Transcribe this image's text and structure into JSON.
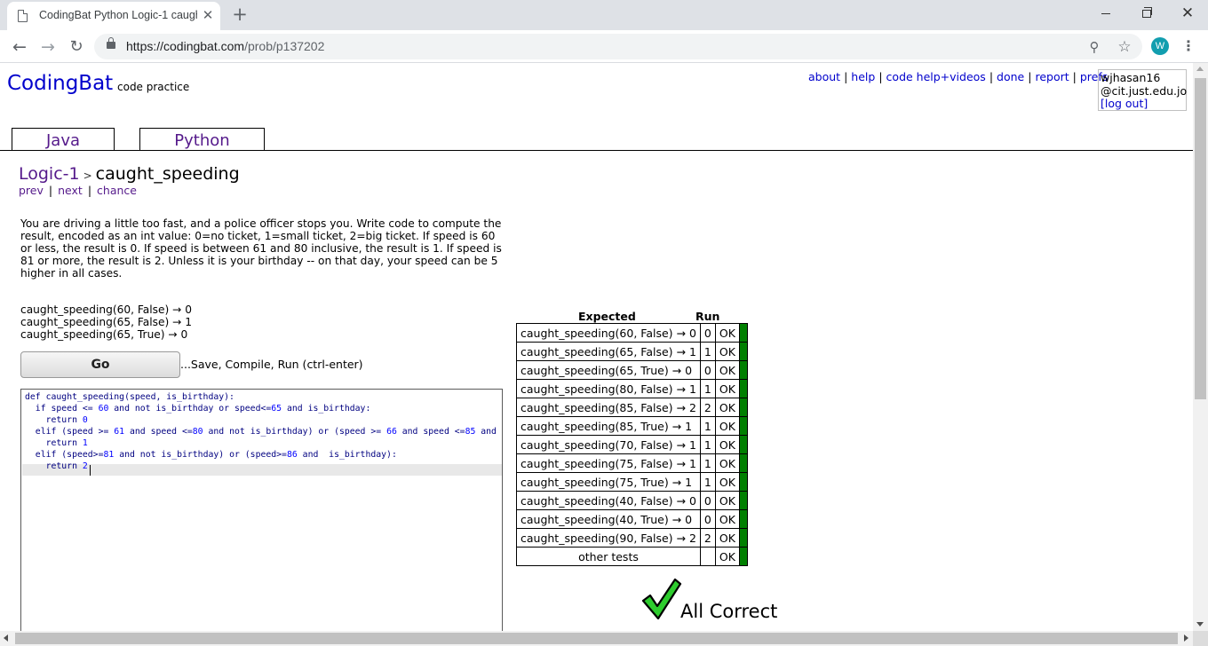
{
  "browser": {
    "tab_title": "CodingBat Python Logic-1 caugh",
    "tab_close": "✕",
    "new_tab": "+",
    "url_host": "https://codingbat.com",
    "url_path": "/prob/p137202",
    "profile_initial": "W"
  },
  "site": {
    "logo": "CodingBat",
    "tagline": "code practice",
    "links": [
      "about",
      "help",
      "code help+videos",
      "done",
      "report",
      "prefs"
    ],
    "user": {
      "name": "wjhasan16",
      "email": "@cit.just.edu.jo",
      "logout": "[log out]"
    },
    "language_tabs": [
      "Java",
      "Python"
    ]
  },
  "problem": {
    "section": "Logic-1",
    "chevron": ">",
    "name": "caught_speeding",
    "nav": [
      "prev",
      "next",
      "chance"
    ],
    "description": "You are driving a little too fast, and a police officer stops you. Write code to compute the result, encoded as an int value: 0=no ticket, 1=small ticket, 2=big ticket. If speed is 60 or less, the result is 0. If speed is between 61 and 80 inclusive, the result is 1. If speed is 81 or more, the result is 2. Unless it is your birthday -- on that day, your speed can be 5 higher in all cases.",
    "examples": [
      "caught_speeding(60, False) → 0",
      "caught_speeding(65, False) → 1",
      "caught_speeding(65, True) → 0"
    ],
    "go_button": "Go",
    "go_hint": "...Save, Compile, Run (ctrl-enter)"
  },
  "editor": {
    "lines": [
      "def caught_speeding(speed, is_birthday):",
      "  if speed <= 60 and not is_birthday or speed<=65 and is_birthday:",
      "    return 0",
      "  elif (speed >= 61 and speed <=80 and not is_birthday) or (speed >= 66 and speed <=85 and",
      "    return 1",
      "  elif (speed>=81 and not is_birthday) or (speed>=86 and  is_birthday):",
      "    return 2"
    ]
  },
  "results": {
    "header_expected": "Expected",
    "header_run": "Run",
    "rows": [
      {
        "call": "caught_speeding(60, False) → 0",
        "run": "0",
        "status": "OK"
      },
      {
        "call": "caught_speeding(65, False) → 1",
        "run": "1",
        "status": "OK"
      },
      {
        "call": "caught_speeding(65, True) → 0",
        "run": "0",
        "status": "OK"
      },
      {
        "call": "caught_speeding(80, False) → 1",
        "run": "1",
        "status": "OK"
      },
      {
        "call": "caught_speeding(85, False) → 2",
        "run": "2",
        "status": "OK"
      },
      {
        "call": "caught_speeding(85, True) → 1",
        "run": "1",
        "status": "OK"
      },
      {
        "call": "caught_speeding(70, False) → 1",
        "run": "1",
        "status": "OK"
      },
      {
        "call": "caught_speeding(75, False) → 1",
        "run": "1",
        "status": "OK"
      },
      {
        "call": "caught_speeding(75, True) → 1",
        "run": "1",
        "status": "OK"
      },
      {
        "call": "caught_speeding(40, False) → 0",
        "run": "0",
        "status": "OK"
      },
      {
        "call": "caught_speeding(40, True) → 0",
        "run": "0",
        "status": "OK"
      },
      {
        "call": "caught_speeding(90, False) → 2",
        "run": "2",
        "status": "OK"
      }
    ],
    "other_tests": {
      "label": "other tests",
      "run": "",
      "status": "OK"
    },
    "all_correct": "All Correct",
    "pass_color": "#008000"
  },
  "colors": {
    "link_blue": "#0000cc",
    "link_visited": "#551a8b",
    "code_keyword": "#000080",
    "code_number": "#0000ff",
    "check_green": "#2ecc2e"
  }
}
